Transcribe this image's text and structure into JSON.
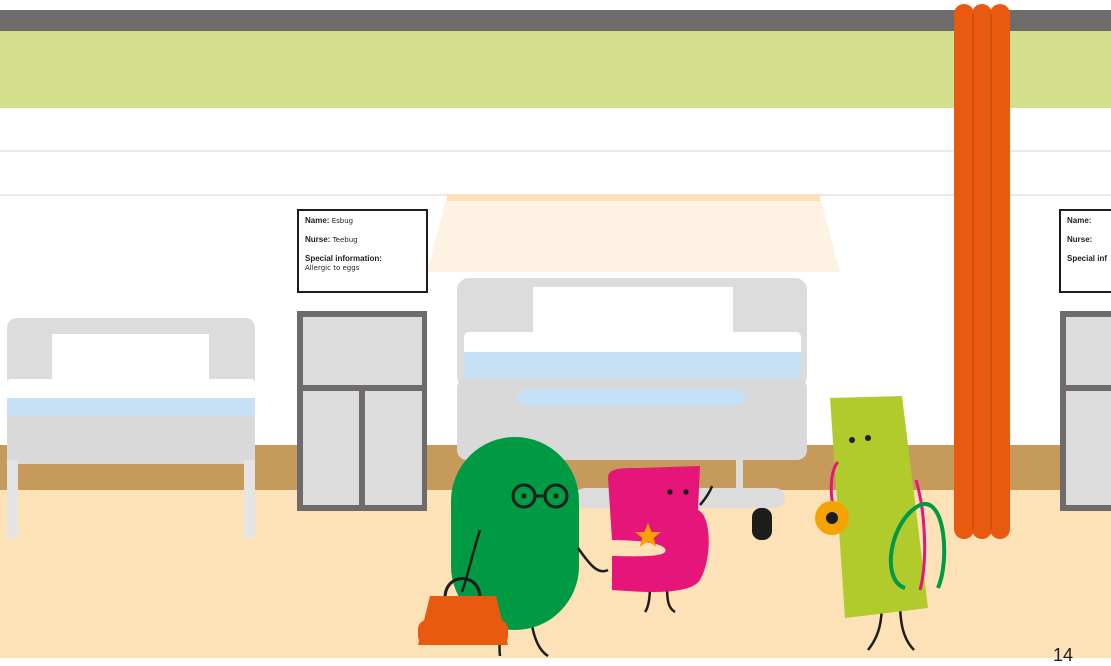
{
  "scene": {
    "description_colors": {
      "ceiling": "#6f6b6b",
      "wall_upper": "#d4e08e",
      "wall": "#ffffff",
      "skirting": "#c69a5a",
      "floor": "#fde2b8",
      "curtain": "#e85a0f",
      "bed_frame": "#d9d9d9",
      "sheet": "#c6e0f5"
    }
  },
  "bed_card_center": {
    "name_label": "Name:",
    "name_value": "Esbug",
    "nurse_label": "Nurse:",
    "nurse_value": "Teebug",
    "special_label": "Special information:",
    "special_value": "Allergic to eggs"
  },
  "bed_card_right": {
    "name_label": "Name:",
    "nurse_label": "Nurse:",
    "special_label": "Special inf"
  },
  "characters": {
    "green_character": {
      "color": "#009a44",
      "item": "handbag-icon"
    },
    "pink_character": {
      "color": "#e6157a",
      "badge": "star-icon"
    },
    "lime_character": {
      "color": "#b1cb2d",
      "item": "stethoscope-icon"
    }
  },
  "page": {
    "number": "14"
  }
}
